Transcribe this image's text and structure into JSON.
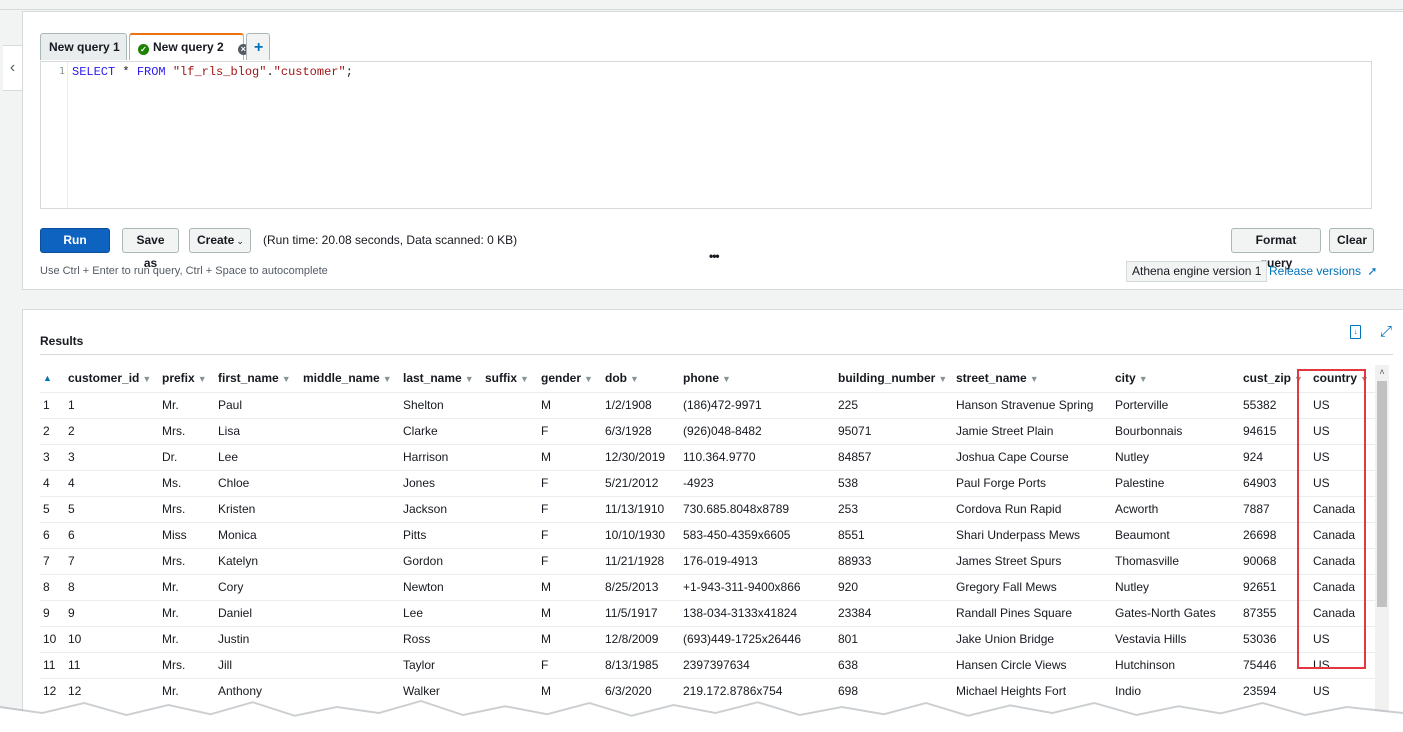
{
  "editor": {
    "tabs": [
      {
        "label": "New query 1"
      },
      {
        "label": "New query 2",
        "status": "success",
        "active": true
      }
    ],
    "add_tab_label": "+",
    "line_number": "1",
    "query": {
      "kw1": "SELECT",
      "star": " * ",
      "kw2": "FROM",
      "space": " ",
      "db": "\"lf_rls_blog\"",
      "dot": ".",
      "table": "\"customer\"",
      "semi": ";"
    },
    "buttons": {
      "run": "Run query",
      "save_as": "Save as",
      "create": "Create",
      "format": "Format query",
      "clear": "Clear"
    },
    "run_info": "(Run time: 20.08 seconds, Data scanned: 0 KB)",
    "hint": "Use Ctrl + Enter to run query, Ctrl + Space to autocomplete",
    "resize_handle": "•••",
    "engine": "Athena engine version 1",
    "release_link": "Release versions"
  },
  "results": {
    "title": "Results",
    "columns": [
      "customer_id",
      "prefix",
      "first_name",
      "middle_name",
      "last_name",
      "suffix",
      "gender",
      "dob",
      "phone",
      "building_number",
      "street_name",
      "city",
      "cust_zip",
      "country"
    ],
    "rows": [
      [
        "1",
        "1",
        "Mr.",
        "Paul",
        "",
        "Shelton",
        "",
        "M",
        "1/2/1908",
        "(186)472-9971",
        "225",
        "Hanson Stravenue Spring",
        "Porterville",
        "55382",
        "US"
      ],
      [
        "2",
        "2",
        "Mrs.",
        "Lisa",
        "",
        "Clarke",
        "",
        "F",
        "6/3/1928",
        "(926)048-8482",
        "95071",
        "Jamie Street Plain",
        "Bourbonnais",
        "94615",
        "US"
      ],
      [
        "3",
        "3",
        "Dr.",
        "Lee",
        "",
        "Harrison",
        "",
        "M",
        "12/30/2019",
        "110.364.9770",
        "84857",
        "Joshua Cape Course",
        "Nutley",
        "924",
        "US"
      ],
      [
        "4",
        "4",
        "Ms.",
        "Chloe",
        "",
        "Jones",
        "",
        "F",
        "5/21/2012",
        "-4923",
        "538",
        "Paul Forge Ports",
        "Palestine",
        "64903",
        "US"
      ],
      [
        "5",
        "5",
        "Mrs.",
        "Kristen",
        "",
        "Jackson",
        "",
        "F",
        "11/13/1910",
        "730.685.8048x8789",
        "253",
        "Cordova Run Rapid",
        "Acworth",
        "7887",
        "Canada"
      ],
      [
        "6",
        "6",
        "Miss",
        "Monica",
        "",
        "Pitts",
        "",
        "F",
        "10/10/1930",
        "583-450-4359x6605",
        "8551",
        "Shari Underpass Mews",
        "Beaumont",
        "26698",
        "Canada"
      ],
      [
        "7",
        "7",
        "Mrs.",
        "Katelyn",
        "",
        "Gordon",
        "",
        "F",
        "11/21/1928",
        "176-019-4913",
        "88933",
        "James Street Spurs",
        "Thomasville",
        "90068",
        "Canada"
      ],
      [
        "8",
        "8",
        "Mr.",
        "Cory",
        "",
        "Newton",
        "",
        "M",
        "8/25/2013",
        "+1-943-311-9400x866",
        "920",
        "Gregory Fall Mews",
        "Nutley",
        "92651",
        "Canada"
      ],
      [
        "9",
        "9",
        "Mr.",
        "Daniel",
        "",
        "Lee",
        "",
        "M",
        "11/5/1917",
        "138-034-3133x41824",
        "23384",
        "Randall Pines Square",
        "Gates-North Gates",
        "87355",
        "Canada"
      ],
      [
        "10",
        "10",
        "Mr.",
        "Justin",
        "",
        "Ross",
        "",
        "M",
        "12/8/2009",
        "(693)449-1725x26446",
        "801",
        "Jake Union Bridge",
        "Vestavia Hills",
        "53036",
        "US"
      ],
      [
        "11",
        "11",
        "Mrs.",
        "Jill",
        "",
        "Taylor",
        "",
        "F",
        "8/13/1985",
        "2397397634",
        "638",
        "Hansen Circle Views",
        "Hutchinson",
        "75446",
        "US"
      ],
      [
        "12",
        "12",
        "Mr.",
        "Anthony",
        "",
        "Walker",
        "",
        "M",
        "6/3/2020",
        "219.172.8786x754",
        "698",
        "Michael Heights Fort",
        "Indio",
        "23594",
        "US"
      ]
    ]
  },
  "colors": {
    "primary_button": "#0e63c0",
    "active_tab_border": "#ec7211",
    "link": "#0073bb",
    "highlight_box": "#e3383f"
  },
  "icons": [
    "chevron-left-icon",
    "info-icon",
    "check-circle-icon",
    "close-circle-icon",
    "plus-icon",
    "chevron-down-icon",
    "external-link-icon",
    "download-icon",
    "expand-icon",
    "sort-ascending-icon",
    "caret-down-icon",
    "scroll-up-icon"
  ]
}
